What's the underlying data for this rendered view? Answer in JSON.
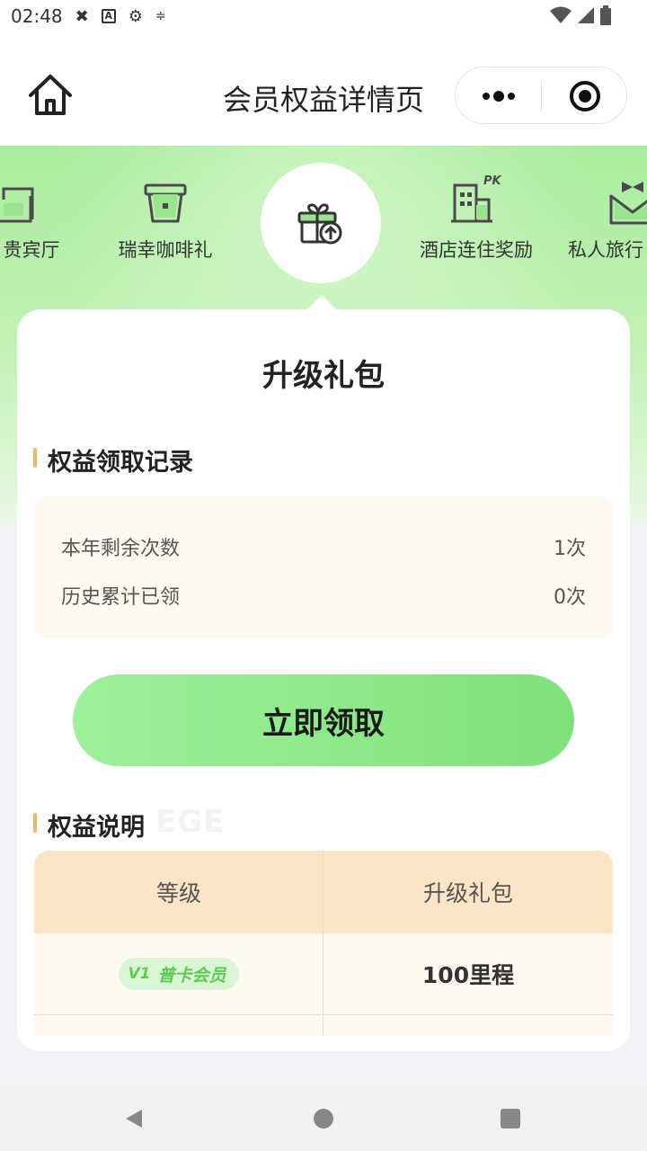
{
  "status_bar": {
    "time": "02:48"
  },
  "nav": {
    "title": "会员权益详情页"
  },
  "tabs": [
    {
      "label": "贵宾厅",
      "icon": "sofa-icon"
    },
    {
      "label": "瑞幸咖啡礼",
      "icon": "coffee-cup-icon"
    },
    {
      "label": "升级礼包",
      "icon": "gift-upgrade-icon",
      "active": true
    },
    {
      "label": "酒店连住奖励",
      "icon": "hotel-pk-icon",
      "badge": "PK"
    },
    {
      "label": "私人旅行",
      "icon": "butler-icon"
    }
  ],
  "card": {
    "title": "升级礼包",
    "record_section": {
      "heading": "权益领取记录",
      "rows": [
        {
          "label": "本年剩余次数",
          "value": "1次"
        },
        {
          "label": "历史累计已领",
          "value": "0次"
        }
      ]
    },
    "claim_button": "立即领取",
    "desc_section": {
      "heading": "权益说明",
      "watermark": "EGE",
      "table": {
        "headers": [
          "等级",
          "升级礼包"
        ],
        "rows": [
          {
            "level_code": "V1",
            "level_name": "普卡会员",
            "value": "100里程"
          }
        ]
      }
    }
  },
  "colors": {
    "accent_green": "#7ee27a",
    "header_orange": "#fbe5c7",
    "record_bg": "#fffaf1"
  }
}
